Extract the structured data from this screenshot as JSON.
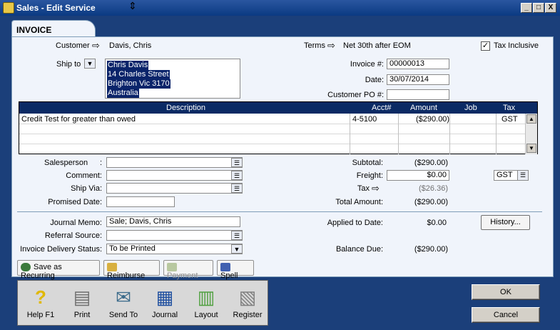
{
  "window": {
    "title": "Sales - Edit Service",
    "min": "_",
    "max": "□",
    "close": "X"
  },
  "tab": {
    "label": "INVOICE"
  },
  "customer": {
    "label": "Customer",
    "value": "Davis, Chris"
  },
  "terms": {
    "label": "Terms",
    "value": "Net 30th after EOM"
  },
  "tax_inclusive": {
    "label": "Tax Inclusive",
    "checked": true
  },
  "ship_to": {
    "label": "Ship to",
    "lines": [
      "Chris Davis",
      "14 Charles Street",
      "Brighton  Vic  3170",
      "Australia"
    ]
  },
  "invoice": {
    "number_label": "Invoice #:",
    "number": "00000013",
    "date_label": "Date:",
    "date": "30/07/2014",
    "po_label": "Customer PO #:",
    "po": ""
  },
  "grid": {
    "headers": {
      "description": "Description",
      "acct": "Acct#",
      "amount": "Amount",
      "job": "Job",
      "tax": "Tax"
    },
    "rows": [
      {
        "description": "Credit Test for greater than owed",
        "acct": "4-5100",
        "amount": "($290.00)",
        "job": "",
        "tax": "GST"
      }
    ]
  },
  "left_fields": {
    "salesperson": "Salesperson",
    "salesperson_colon": ":",
    "comment": "Comment:",
    "ship_via": "Ship Via:",
    "promised_date": "Promised Date:"
  },
  "totals": {
    "subtotal_label": "Subtotal:",
    "subtotal": "($290.00)",
    "freight_label": "Freight:",
    "freight": "$0.00",
    "freight_tax": "GST",
    "tax_label": "Tax",
    "tax": "($26.36)",
    "total_label": "Total Amount:",
    "total": "($290.00)"
  },
  "bottom": {
    "journal_memo_label": "Journal Memo:",
    "journal_memo": "Sale; Davis, Chris",
    "referral_label": "Referral Source:",
    "referral": "",
    "delivery_label": "Invoice Delivery Status:",
    "delivery": "To be Printed",
    "applied_label": "Applied to Date:",
    "applied": "$0.00",
    "history_label": "History...",
    "balance_label": "Balance Due:",
    "balance": "($290.00)"
  },
  "action_buttons": {
    "save_recurring": "Save as Recurring",
    "reimburse": "Reimburse",
    "payment": "Payment",
    "spell": "Spell"
  },
  "toolbar": {
    "help": "Help F1",
    "print": "Print",
    "send_to": "Send To",
    "journal": "Journal",
    "layout": "Layout",
    "register": "Register"
  },
  "dialog": {
    "ok": "OK",
    "cancel": "Cancel"
  },
  "colors": {
    "title_bar": "#0b3a82",
    "grid_header": "#0b2a64",
    "background": "#1b3f7a",
    "panel": "#f0f4fb"
  }
}
